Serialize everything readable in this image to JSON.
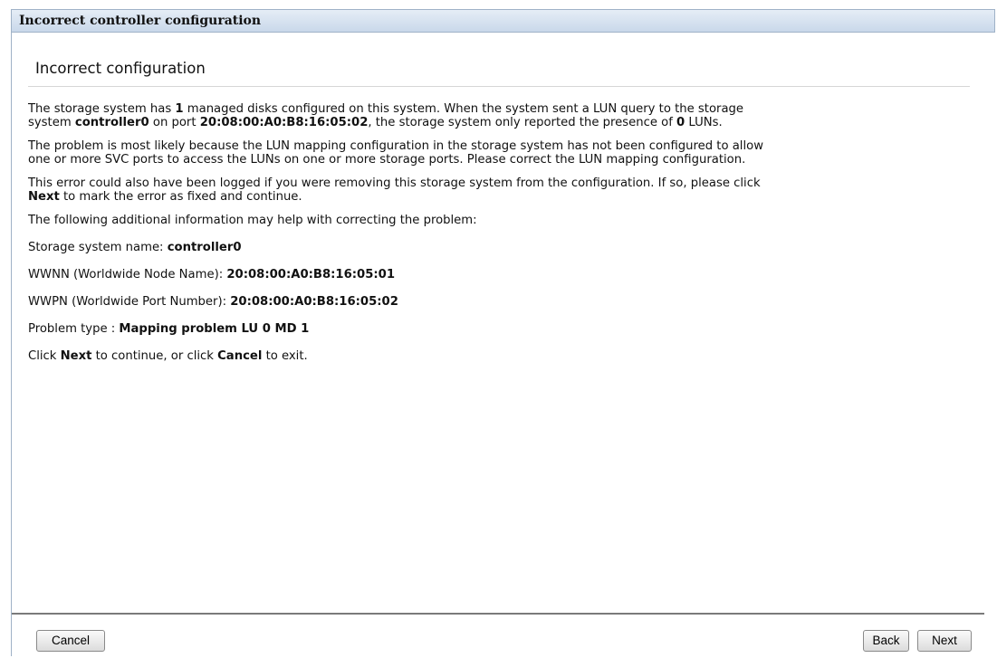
{
  "window": {
    "title": "Incorrect controller configuration"
  },
  "heading": "Incorrect configuration",
  "p1": {
    "t1": "The storage system has ",
    "b1": "1",
    "t2": " managed disks configured on this system. When the system sent a LUN query to the storage",
    "t3": "system ",
    "b2": "controller0",
    "t4": " on port ",
    "b3": "20:08:00:A0:B8:16:05:02",
    "t5": ", the storage system only reported the presence of ",
    "b4": "0",
    "t6": " LUNs."
  },
  "p2": {
    "line1": "The problem is most likely because the LUN mapping configuration in the storage system has not been configured to allow",
    "line2": "one or more SVC ports to access the LUNs on one or more storage ports. Please correct the LUN mapping configuration."
  },
  "p3": {
    "line1": "This error could also have been logged if you were removing this storage system from the configuration. If so, please click",
    "b1": "Next",
    "t2": " to mark the error as fixed and continue."
  },
  "p4": "The following additional information may help with correcting the problem:",
  "info": {
    "name_label": "Storage system name: ",
    "name_value": "controller0",
    "wwnn_label": "WWNN (Worldwide Node Name): ",
    "wwnn_value": "20:08:00:A0:B8:16:05:01",
    "wwpn_label": "WWPN (Worldwide Port Number): ",
    "wwpn_value": "20:08:00:A0:B8:16:05:02",
    "ptype_label": "Problem type : ",
    "ptype_value": "Mapping problem LU 0 MD 1"
  },
  "closing": {
    "t1": "Click ",
    "b1": "Next",
    "t2": " to continue, or click ",
    "b2": "Cancel",
    "t3": " to exit."
  },
  "buttons": {
    "cancel": "Cancel",
    "back": "Back",
    "next": "Next"
  }
}
